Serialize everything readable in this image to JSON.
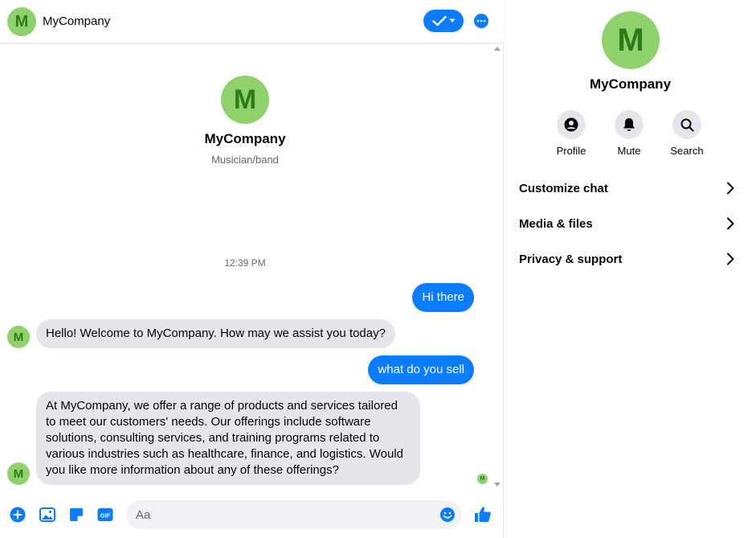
{
  "header": {
    "avatar_letter": "M",
    "name": "MyCompany"
  },
  "intro": {
    "avatar_letter": "M",
    "name": "MyCompany",
    "subtitle": "Musician/band"
  },
  "timestamp": "12:39 PM",
  "messages": [
    {
      "from": "me",
      "text": "Hi there"
    },
    {
      "from": "page",
      "avatar_letter": "M",
      "text": "Hello! Welcome to MyCompany. How may we assist you today?"
    },
    {
      "from": "me",
      "text": "what do you sell"
    },
    {
      "from": "page",
      "avatar_letter": "M",
      "text": "At MyCompany, we offer a range of products and services tailored to meet our customers' needs. Our offerings include software solutions, consulting services, and training programs related to various industries such as healthcare, finance, and logistics. Would you like more information about any of these offerings?"
    }
  ],
  "seen_avatar_letter": "M",
  "composer": {
    "placeholder": "Aa",
    "icons": [
      "plus-icon",
      "photo-icon",
      "sticker-icon",
      "gif-icon",
      "emoji-icon",
      "thumbs-up-icon"
    ],
    "gif_label": "GIF"
  },
  "info_panel": {
    "avatar_letter": "M",
    "name": "MyCompany",
    "actions": [
      {
        "label": "Profile",
        "icon": "profile-icon"
      },
      {
        "label": "Mute",
        "icon": "bell-icon"
      },
      {
        "label": "Search",
        "icon": "search-icon"
      }
    ],
    "sections": [
      {
        "label": "Customize chat"
      },
      {
        "label": "Media & files"
      },
      {
        "label": "Privacy & support"
      }
    ]
  },
  "colors": {
    "accent": "#0a7cff",
    "avatar_bg": "#8fd16a",
    "avatar_fg": "#2d7a1a",
    "incoming_bubble": "#e4e6eb"
  }
}
